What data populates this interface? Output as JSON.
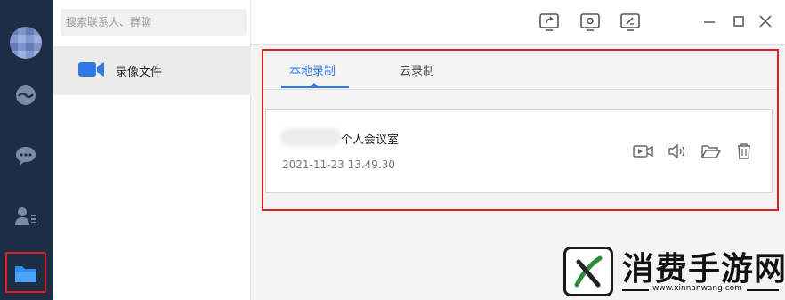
{
  "search": {
    "placeholder": "搜索联系人、群聊"
  },
  "sidebar": {
    "item_label": "录像文件"
  },
  "tabs": [
    {
      "label": "本地录制",
      "active": true
    },
    {
      "label": "云录制",
      "active": false
    }
  ],
  "recording": {
    "title": "个人会议室",
    "time": "2021-11-23 13.49.30"
  },
  "watermark": {
    "text": "消费手游网",
    "url": "www.xinnanwang.com"
  },
  "colors": {
    "accent": "#2f7ae5",
    "highlight": "#e02020",
    "rail": "#1f2d44"
  }
}
